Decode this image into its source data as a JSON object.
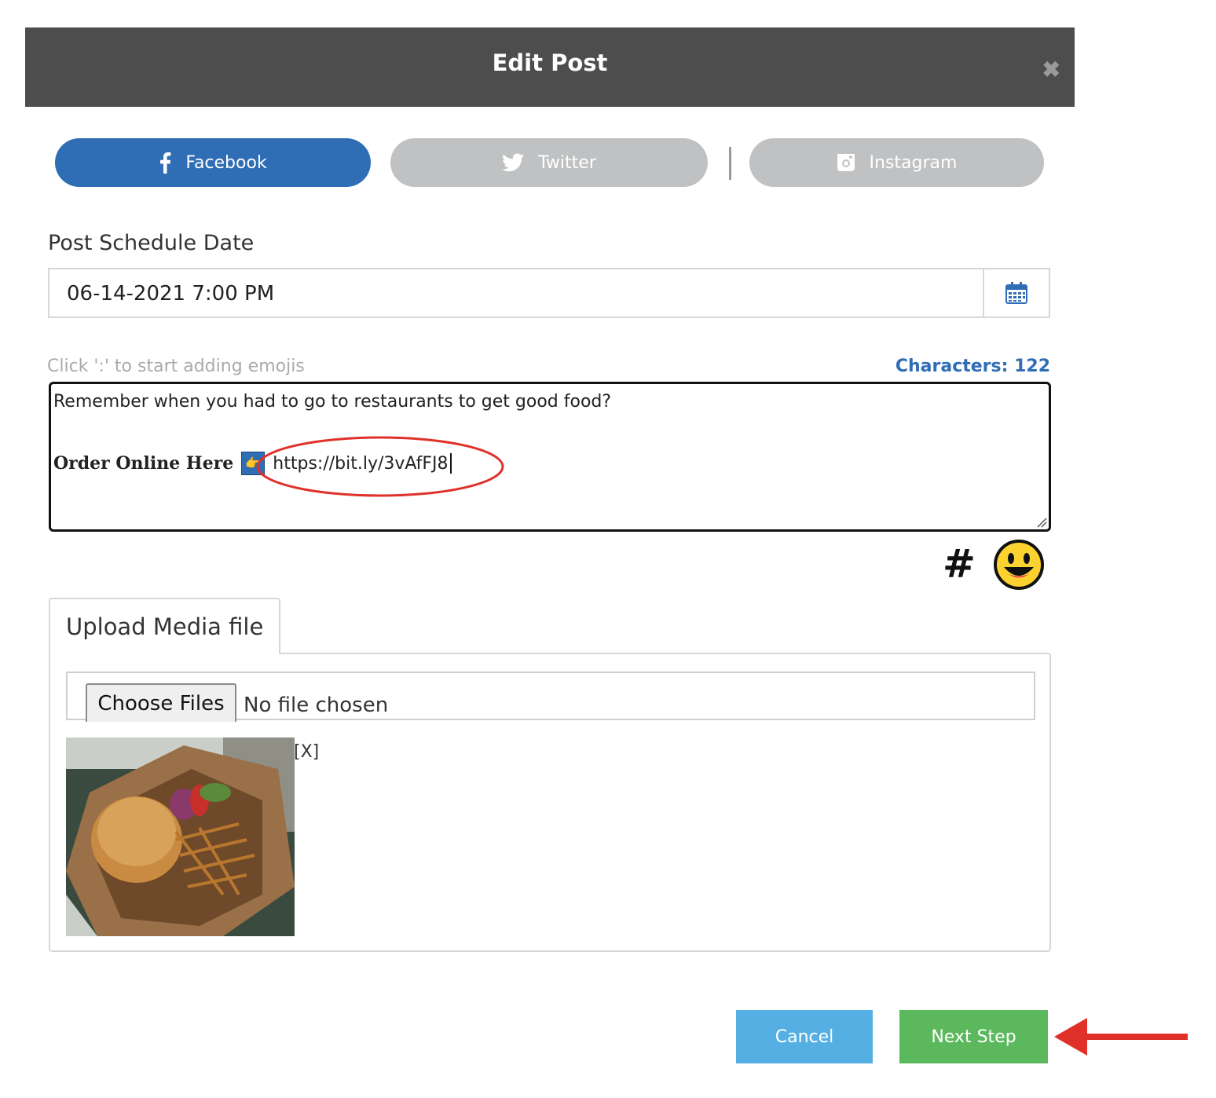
{
  "modal": {
    "title": "Edit Post",
    "close_icon": "close-icon"
  },
  "networks": [
    {
      "label": "Facebook",
      "icon": "facebook-icon",
      "active": true,
      "color": "#2f6db5"
    },
    {
      "label": "Twitter",
      "icon": "twitter-icon",
      "active": false,
      "color": "#bfc1c3"
    },
    {
      "label": "Instagram",
      "icon": "instagram-icon",
      "active": false,
      "color": "#bfc1c3"
    }
  ],
  "schedule": {
    "label": "Post Schedule Date",
    "value": "06-14-2021 7:00 PM",
    "icon": "calendar-icon"
  },
  "editor": {
    "hint": "Click ':' to start adding emojis",
    "char_count": "Characters: 122",
    "line1": "Remember when you had to go to restaurants to get good food?",
    "order_label": "Order Online Here",
    "emoji": "👉",
    "link": "https://bit.ly/3vAfFJ8",
    "hashtag": "#",
    "emoji_button_icon": "smiley-icon"
  },
  "upload": {
    "tab_label": "Upload Media file",
    "choose_label": "Choose Files",
    "no_file": "No file chosen",
    "remove_label": "[X]"
  },
  "footer": {
    "cancel_label": "Cancel",
    "next_label": "Next Step"
  },
  "colors": {
    "header_bg": "#4d4d4d",
    "facebook": "#2f6db5",
    "inactive": "#bfc1c3",
    "cancel": "#56afe3",
    "next": "#5cb85c",
    "annotation_red": "#e0302a"
  }
}
